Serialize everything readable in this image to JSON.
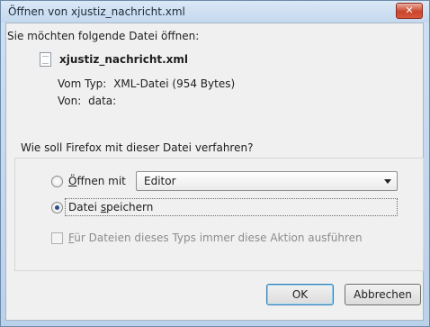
{
  "window": {
    "title": "Öffnen von xjustiz_nachricht.xml",
    "close_glyph": "✕"
  },
  "intro_text": "Sie möchten folgende Datei öffnen:",
  "file": {
    "name": "xjustiz_nachricht.xml",
    "icon": "document-icon"
  },
  "info": {
    "type_label": "Vom Typ:",
    "type_value": "XML-Datei (954 Bytes)",
    "from_label": "Von:",
    "from_value": "data:"
  },
  "question": "Wie soll Firefox mit dieser Datei verfahren?",
  "options": {
    "open_with": {
      "prefix_mnemonic": "Ö",
      "rest": "ffnen mit",
      "selected": false
    },
    "application_select": {
      "value": "Editor"
    },
    "save": {
      "prefix": "Datei ",
      "mnemonic": "s",
      "rest": "peichern",
      "selected": true
    },
    "always": {
      "mnemonic": "F",
      "rest": "ür Dateien dieses Typs immer diese Aktion ausführen",
      "checked": false,
      "disabled": true
    }
  },
  "buttons": {
    "ok": "OK",
    "cancel": "Abbrechen"
  },
  "colors": {
    "title_bar": "#c4d8ee",
    "close_button": "#c8452b",
    "dialog_bg": "#f0f0f0"
  }
}
